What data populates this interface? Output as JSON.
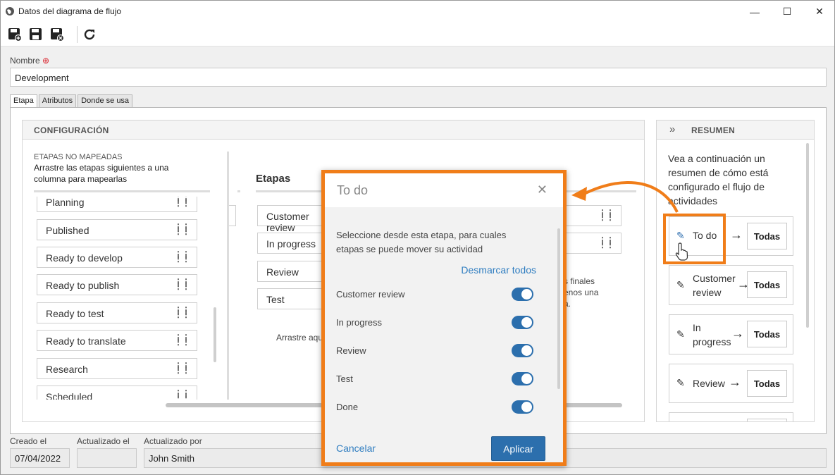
{
  "window": {
    "title": "Datos del diagrama de flujo",
    "controls": {
      "minimize": "—",
      "maximize": "☐",
      "close": "✕"
    }
  },
  "toolbar": {
    "icons": [
      "save-new-icon",
      "save-icon",
      "save-close-icon",
      "refresh-icon"
    ]
  },
  "form": {
    "name_label": "Nombre",
    "name_value": "Development",
    "required_mark": "⊕"
  },
  "tabs": [
    "Etapa",
    "Atributos",
    "Donde se usa"
  ],
  "config": {
    "header": "CONFIGURACIÓN",
    "unmapped_title": "ETAPAS NO MAPEADAS",
    "unmapped_hint": "Arrastre las etapas siguientes a una columna para mapearlas",
    "unmapped_items": [
      "Planning",
      "Published",
      "Ready to develop",
      "Ready to publish",
      "Ready to test",
      "Ready to translate",
      "Research",
      "Scheduled"
    ],
    "stages_title": "Etapas",
    "stage_items": [
      "Customer review",
      "In progress",
      "Review",
      "Test"
    ],
    "drag_hint": "Arrastre aquí las etapas del flujo de",
    "final_hint": "s finales\nenos una\na."
  },
  "summary": {
    "header": "RESUMEN",
    "intro": "Vea a continuación un resumen de cómo está configurado el flujo de actividades",
    "cards": [
      {
        "name": "To do",
        "target": "Todas"
      },
      {
        "name": "Customer review",
        "target": "Todas"
      },
      {
        "name": "In progress",
        "target": "Todas"
      },
      {
        "name": "Review",
        "target": "Todas"
      },
      {
        "name": "",
        "target": ""
      }
    ]
  },
  "modal": {
    "title": "To do",
    "close": "✕",
    "description": "Seleccione desde esta etapa, para cuales etapas se puede mover su actividad",
    "deselect_all": "Desmarcar todos",
    "toggles": [
      {
        "label": "Customer review",
        "on": true
      },
      {
        "label": "In progress",
        "on": true
      },
      {
        "label": "Review",
        "on": true
      },
      {
        "label": "Test",
        "on": true
      },
      {
        "label": "Done",
        "on": true
      }
    ],
    "cancel": "Cancelar",
    "apply": "Aplicar"
  },
  "footer": {
    "created_label": "Creado el",
    "created_value": "07/04/2022",
    "updated_label": "Actualizado el",
    "updated_value": "",
    "updated_by_label": "Actualizado por",
    "updated_by_value": "John Smith"
  },
  "colors": {
    "accent": "#2c6fad",
    "highlight": "#f07d19",
    "link": "#2f7dc0"
  }
}
